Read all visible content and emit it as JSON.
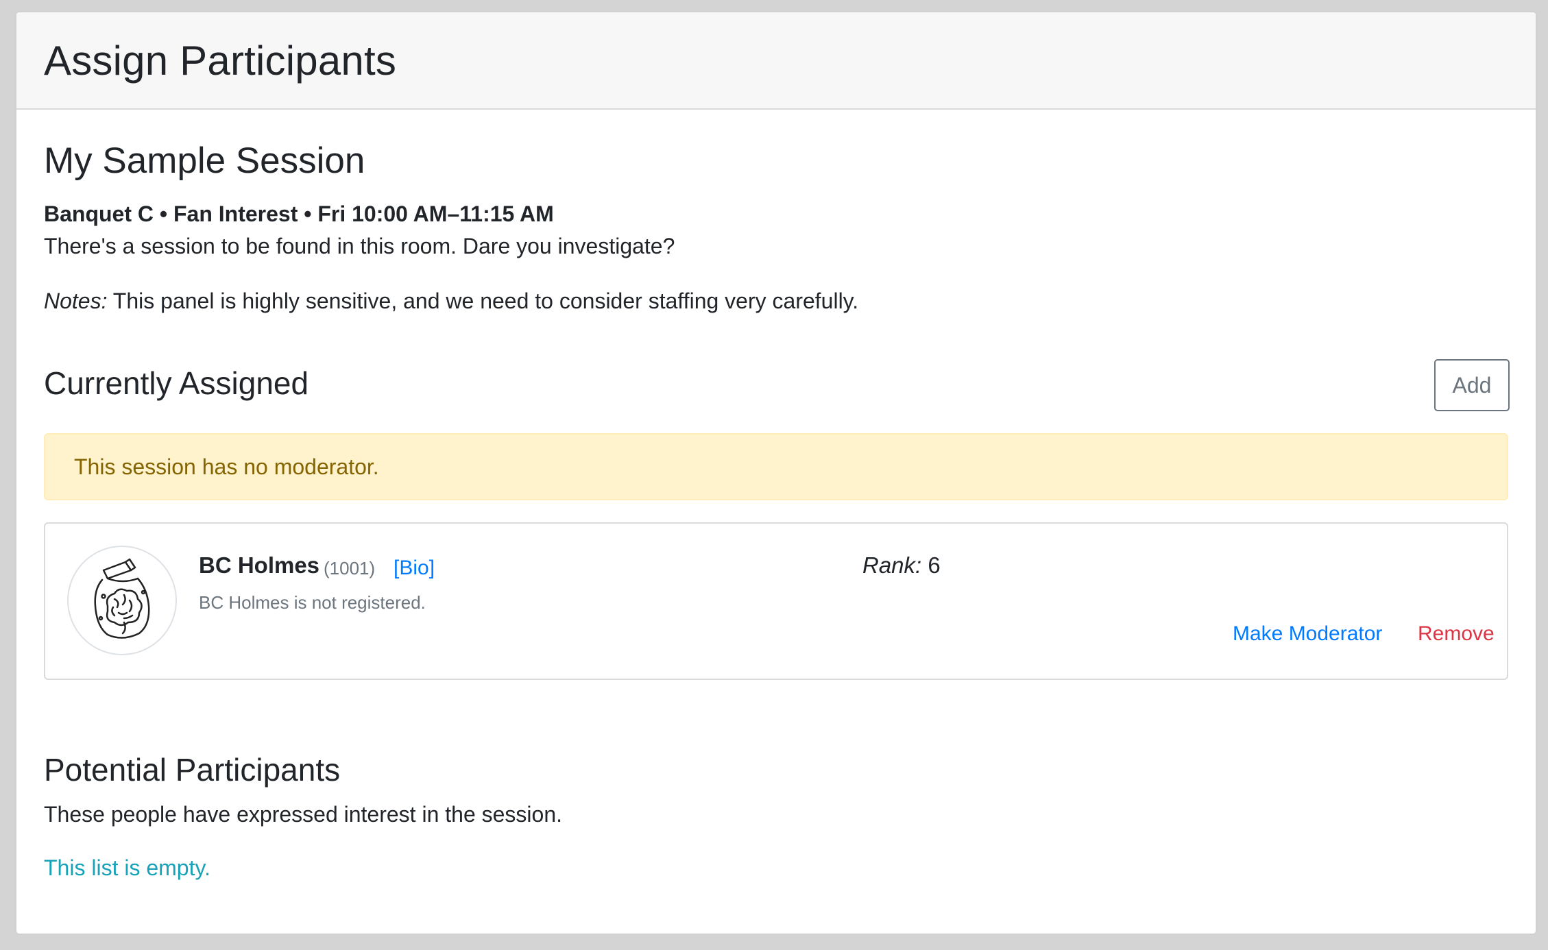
{
  "header": {
    "title": "Assign Participants"
  },
  "session": {
    "title": "My Sample Session",
    "meta": "Banquet C • Fan Interest • Fri 10:00 AM–11:15 AM",
    "description": "There's a session to be found in this room. Dare you investigate?",
    "notes_label": "Notes:",
    "notes_text": " This panel is highly sensitive, and we need to consider staffing very carefully."
  },
  "assigned": {
    "heading": "Currently Assigned",
    "add_label": "Add",
    "warning": "This session has no moderator.",
    "participants": [
      {
        "name": "BC Holmes",
        "id": "(1001)",
        "bio_label": "[Bio]",
        "status": "BC Holmes is not registered.",
        "rank_label": "Rank:",
        "rank_value": " 6",
        "make_moderator_label": "Make Moderator",
        "remove_label": "Remove",
        "avatar_icon": "brain-jar-icon"
      }
    ]
  },
  "potential": {
    "heading": "Potential Participants",
    "description": "These people have expressed interest in the session.",
    "empty_text": "This list is empty."
  },
  "colors": {
    "link": "#007bff",
    "danger": "#dc3545",
    "info": "#17a2b8",
    "warning_bg": "#fff3cd",
    "warning_text": "#856404"
  }
}
